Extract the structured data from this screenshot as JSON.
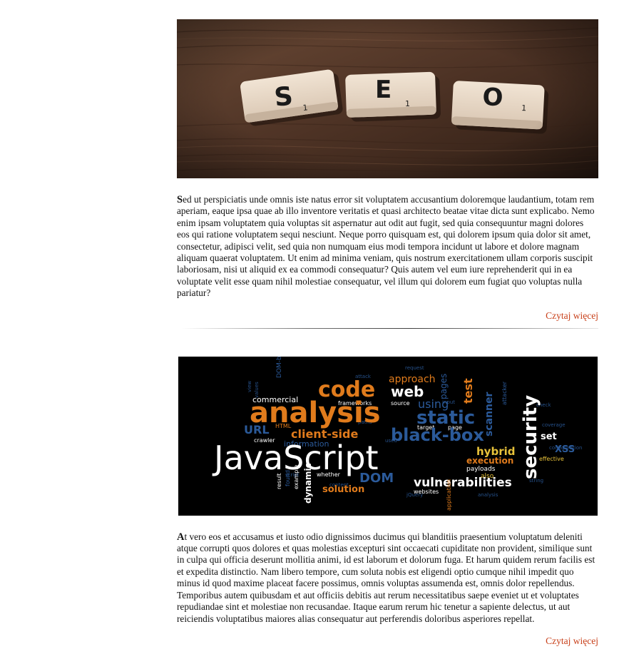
{
  "posts": [
    {
      "image_alt": "SEO tiles",
      "image_tiles": [
        "S",
        "E",
        "O"
      ],
      "image_tile_subscripts": [
        "1",
        "1",
        "1"
      ],
      "dropcap": "S",
      "text": "ed ut perspiciatis unde omnis iste natus error sit voluptatem accusantium doloremque laudantium, totam rem aperiam, eaque ipsa quae ab illo inventore veritatis et quasi architecto beatae vitae dicta sunt explicabo. Nemo enim ipsam voluptatem quia voluptas sit aspernatur aut odit aut fugit, sed quia consequuntur magni dolores eos qui ratione voluptatem sequi nesciunt. Neque porro quisquam est, qui dolorem ipsum quia dolor sit amet, consectetur, adipisci velit, sed quia non numquam eius modi tempora incidunt ut labore et dolore magnam aliquam quaerat voluptatem. Ut enim ad minima veniam, quis nostrum exercitationem ullam corporis suscipit laboriosam, nisi ut aliquid ex ea commodi consequatur? Quis autem vel eum iure reprehenderit qui in ea voluptate velit esse quam nihil molestiae consequatur, vel illum qui dolorem eum fugiat quo voluptas nulla pariatur?",
      "read_more": "Czytaj więcej"
    },
    {
      "image_alt": "JavaScript security word cloud",
      "word_cloud": {
        "javascript": "JavaScript",
        "analysis": "analysis",
        "code": "code",
        "web": "web",
        "static": "static",
        "security": "security",
        "vulnerabilities": "vulnerabilities",
        "client_side": "client-side",
        "black_box": "black-box",
        "hybrid": "hybrid",
        "execution": "execution",
        "solution": "solution",
        "dom": "DOM",
        "url": "URL",
        "scanner": "scanner",
        "commercial": "commercial",
        "approach": "approach",
        "test": "test",
        "set": "set",
        "xss": "XSS",
        "dynamic": "dynamic",
        "websites": "websites",
        "payloads": "payloads",
        "frameworks": "frameworks",
        "source": "source",
        "using": "using",
        "pages": "pages",
        "information": "information",
        "crawler": "crawler",
        "html": "HTML",
        "target": "target",
        "page": "page",
        "effective": "effective",
        "also": "also",
        "result": "result",
        "example": "example",
        "found": "found",
        "whether": "whether",
        "application": "application",
        "dom_based": "DOM-based",
        "attacker": "attacker"
      },
      "colors": {
        "orange": "#e07b1c",
        "blue": "#2b5a9a",
        "white": "#ffffff",
        "yellow": "#e8c23a",
        "background": "#000000"
      },
      "dropcap": "A",
      "text": "t vero eos et accusamus et iusto odio dignissimos ducimus qui blanditiis praesentium voluptatum deleniti atque corrupti quos dolores et quas molestias excepturi sint occaecati cupiditate non provident, similique sunt in culpa qui officia deserunt mollitia animi, id est laborum et dolorum fuga. Et harum quidem rerum facilis est et expedita distinctio. Nam libero tempore, cum soluta nobis est eligendi optio cumque nihil impedit quo minus id quod maxime placeat facere possimus, omnis voluptas assumenda est, omnis dolor repellendus. Temporibus autem quibusdam et aut officiis debitis aut rerum necessitatibus saepe eveniet ut et voluptates repudiandae sint et molestiae non recusandae. Itaque earum rerum hic tenetur a sapiente delectus, ut aut reiciendis voluptatibus maiores alias consequatur aut perferendis doloribus asperiores repellat.",
      "read_more": "Czytaj więcej"
    }
  ]
}
